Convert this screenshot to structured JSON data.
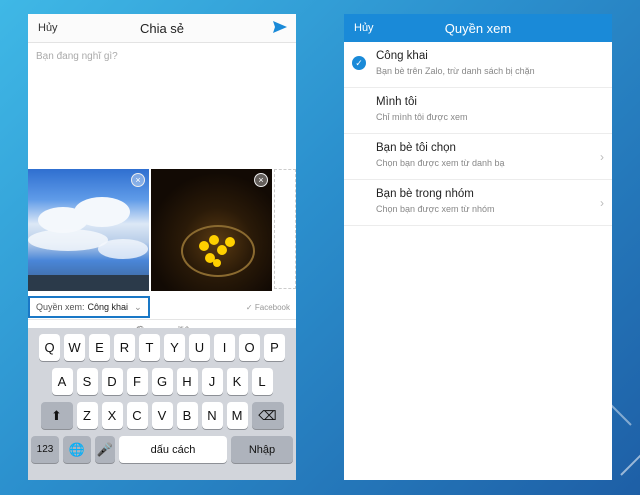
{
  "left_screen": {
    "header": {
      "cancel": "Hủy",
      "title": "Chia sẻ",
      "send_icon": "send-icon"
    },
    "compose_placeholder": "Bạn đang nghĩ gì?",
    "privacy": {
      "label": "Quyền xem:",
      "value": "Công khai"
    },
    "share_target": "Facebook",
    "toolbar_icons": [
      "emoji-icon",
      "image-icon",
      "mic-icon",
      "link-icon",
      "tag-icon",
      "location-icon"
    ],
    "keyboard": {
      "row1": [
        "Q",
        "W",
        "E",
        "R",
        "T",
        "Y",
        "U",
        "I",
        "O",
        "P"
      ],
      "row2": [
        "A",
        "S",
        "D",
        "F",
        "G",
        "H",
        "J",
        "K",
        "L"
      ],
      "row3": [
        "Z",
        "X",
        "C",
        "V",
        "B",
        "N",
        "M"
      ],
      "num_key": "123",
      "space_key": "dấu cách",
      "return_key": "Nhập"
    }
  },
  "right_screen": {
    "header": {
      "cancel": "Hủy",
      "title": "Quyền xem"
    },
    "options": [
      {
        "name": "Công khai",
        "desc": "Bạn bè trên Zalo, trừ danh sách bị chặn",
        "selected": true
      },
      {
        "name": "Mình tôi",
        "desc": "Chỉ mình tôi được xem",
        "selected": false
      },
      {
        "name": "Bạn bè tôi chọn",
        "desc": "Chọn bạn được xem từ danh bạ",
        "selected": false
      },
      {
        "name": "Bạn bè trong nhóm",
        "desc": "Chọn bạn được xem từ nhóm",
        "selected": false
      }
    ]
  },
  "colors": {
    "accent": "#1a8ad8",
    "background": "#2b8fcd"
  }
}
